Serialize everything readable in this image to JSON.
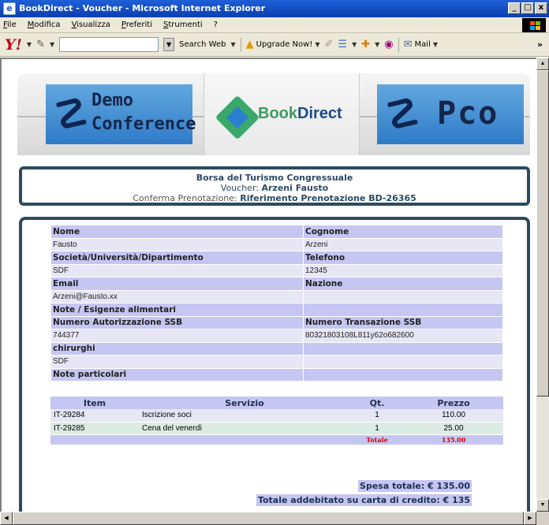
{
  "window": {
    "title": "BookDirect - Voucher - Microsoft Internet Explorer",
    "buttons": [
      "_",
      "□",
      "x"
    ]
  },
  "menu": [
    "File",
    "Modifica",
    "Visualizza",
    "Preferiti",
    "Strumenti",
    "?"
  ],
  "toolbar": {
    "yahoo": "Y!",
    "search_label": "Search Web",
    "upgrade_label": "Upgrade Now!",
    "mail_label": "Mail",
    "more": "»"
  },
  "banner": {
    "left_logo": [
      "Demo",
      "Conference"
    ],
    "center_logo_a": "Book",
    "center_logo_b": "Direct",
    "right_logo": "Pco"
  },
  "header": {
    "line1": "Borsa del Turismo Congressuale",
    "voucher_label": "Voucher:",
    "voucher_name": "Arzeni Fausto",
    "confirm_label": "Conferma Prenotazione:",
    "confirm_ref": "Riferimento Prenotazione BD-26365"
  },
  "form": {
    "rows": [
      {
        "type": "lbl",
        "a": "Nome",
        "b": "Cognome"
      },
      {
        "type": "val",
        "a": "Fausto",
        "b": "Arzeni"
      },
      {
        "type": "lbl",
        "a": "Società/Università/Dipartimento",
        "b": "Telefono"
      },
      {
        "type": "val",
        "a": "SDF",
        "b": "12345"
      },
      {
        "type": "lbl",
        "a": "Email",
        "b": "Nazione"
      },
      {
        "type": "val",
        "a": "Arzeni@Fausto.xx",
        "b": ""
      },
      {
        "type": "lbl",
        "a": "Note / Esigenze alimentari",
        "b": ""
      },
      {
        "type": "lbl",
        "a": "Numero Autorizzazione SSB",
        "b": "Numero Transazione SSB"
      },
      {
        "type": "val",
        "a": "744377",
        "b": "80321803108L811y62o682600"
      },
      {
        "type": "lbl",
        "a": "chirurghi",
        "b": ""
      },
      {
        "type": "val",
        "a": "SDF",
        "b": ""
      },
      {
        "type": "lbl",
        "a": "Note particolari",
        "b": ""
      }
    ]
  },
  "items": {
    "headers": [
      "Item",
      "Servizio",
      "Qt.",
      "Prezzo"
    ],
    "rows": [
      {
        "item": "IT-29284",
        "servizio": "Iscrizione soci",
        "qt": "1",
        "prezzo": "110.00"
      },
      {
        "item": "IT-29285",
        "servizio": "Cena del venerdì",
        "qt": "1",
        "prezzo": "25.00"
      }
    ],
    "total_label": "Totale",
    "total_value": "135.00"
  },
  "summary": {
    "spesa": "Spesa totale: € 135.00",
    "addebitato": "Totale addebitato su carta di credito: € 135"
  }
}
